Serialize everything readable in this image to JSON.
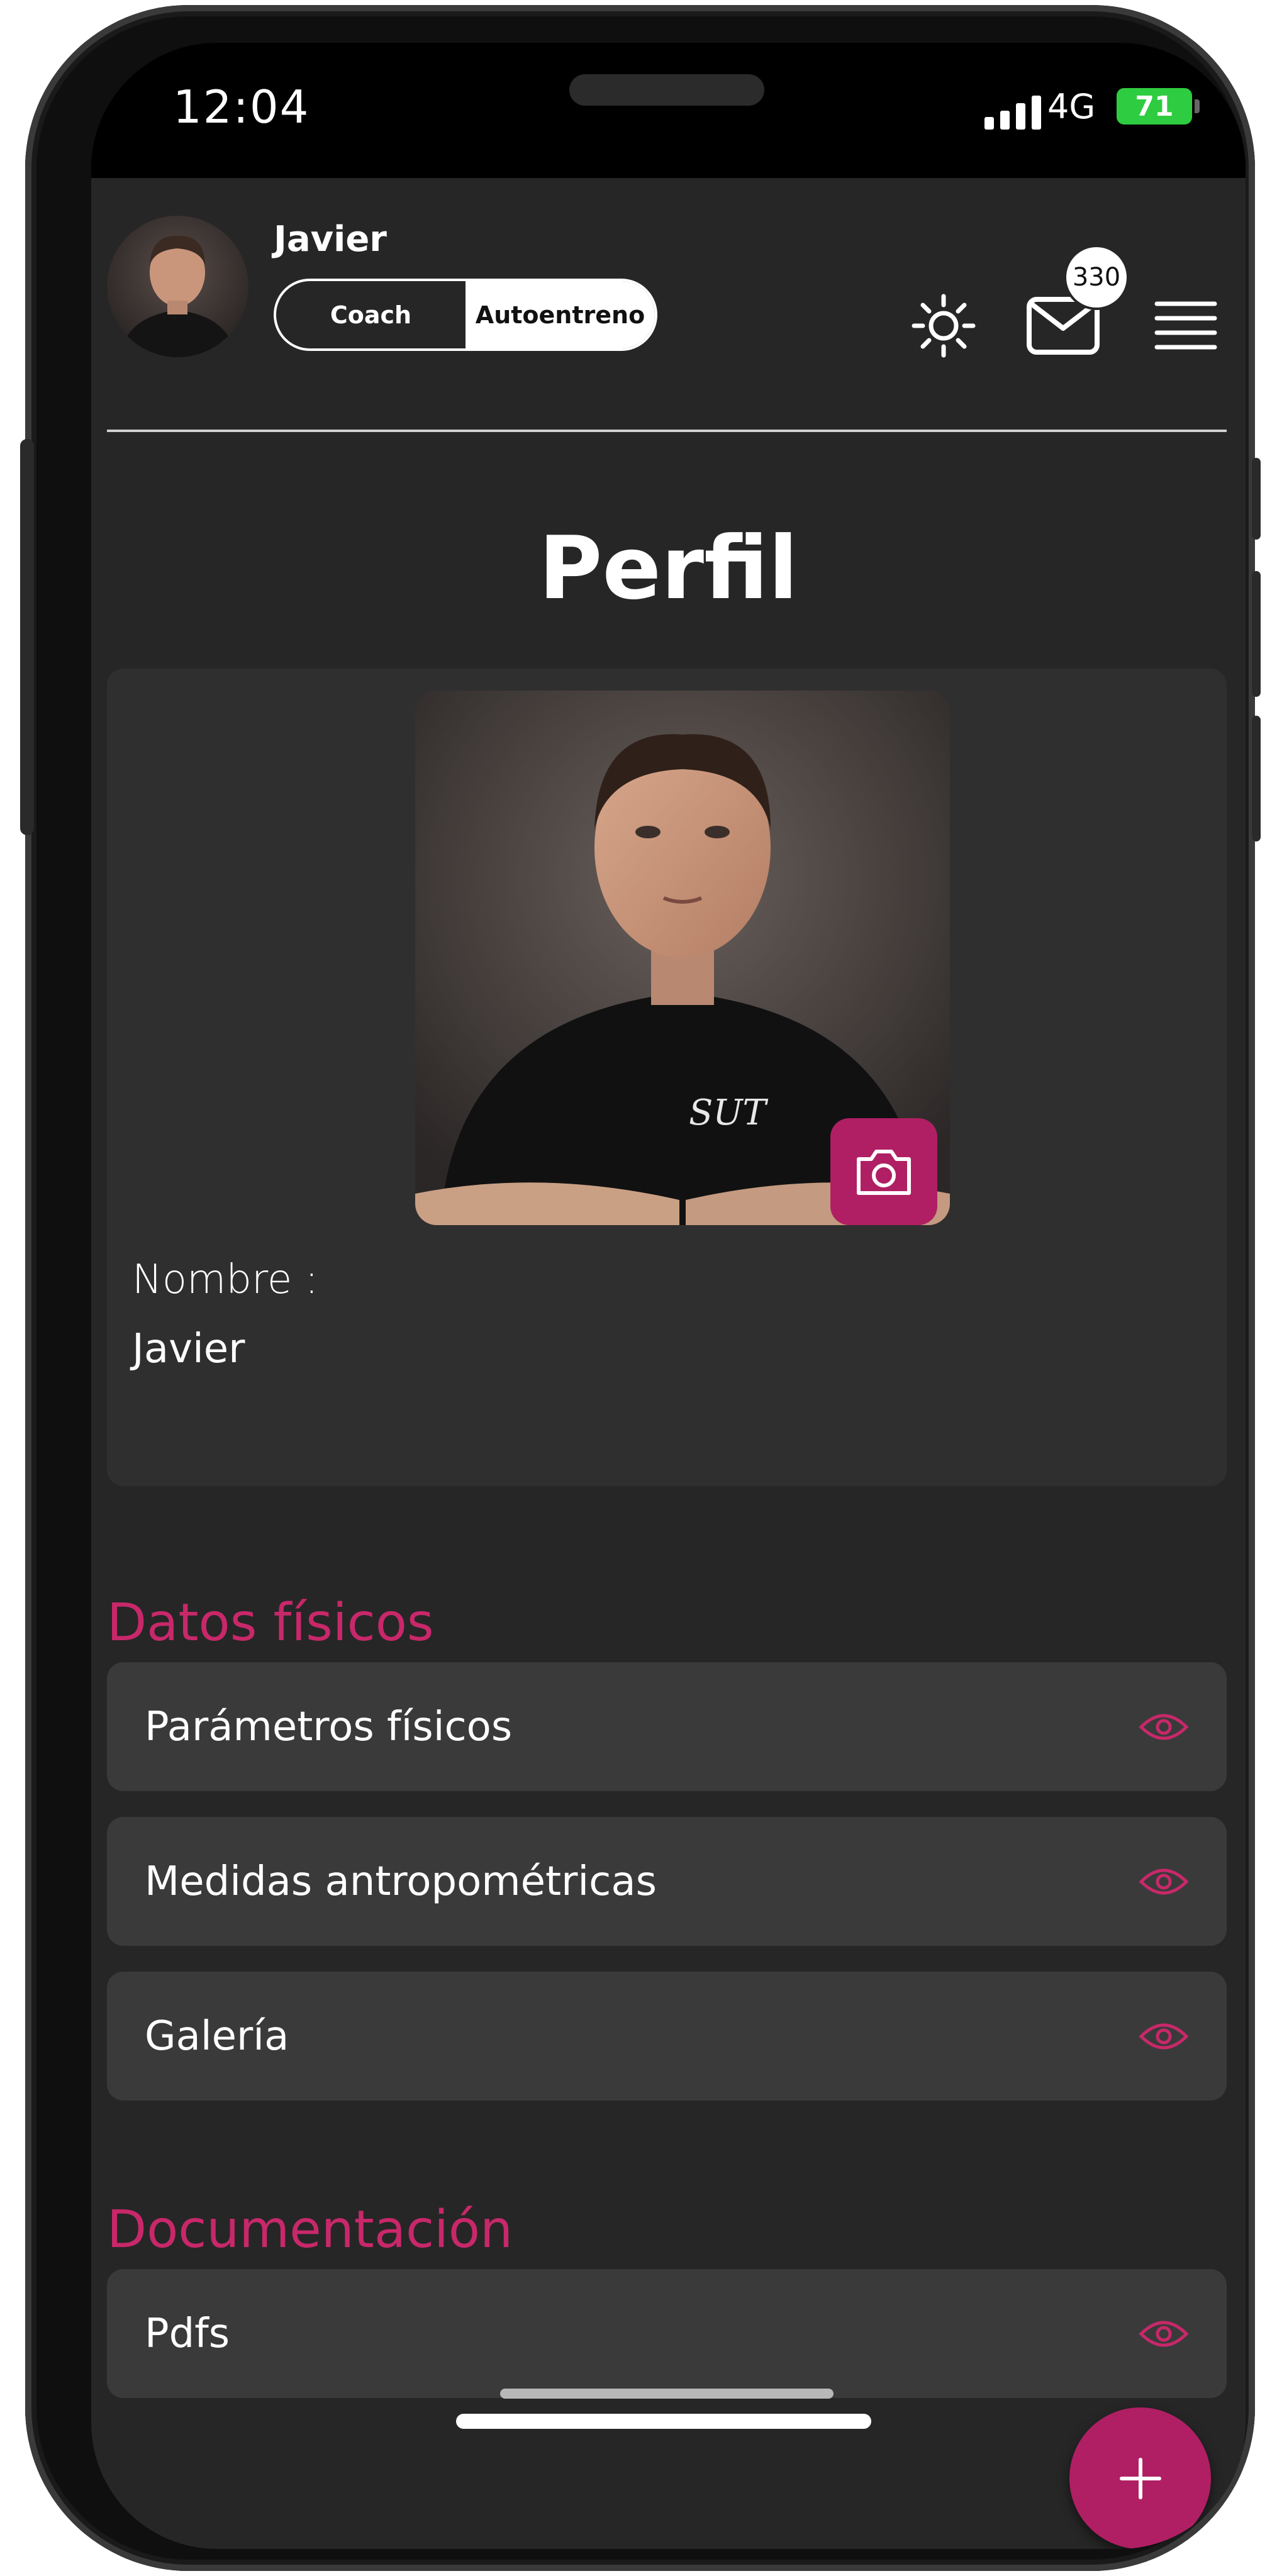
{
  "status": {
    "time": "12:04",
    "network": "4G",
    "battery": "71"
  },
  "header": {
    "user_name": "Javier",
    "mode_options": [
      "Coach",
      "Autoentreno"
    ],
    "active_mode": "Autoentreno",
    "mail_badge": "330",
    "icons": [
      "sun-icon",
      "mail-icon",
      "hamburger-menu-icon"
    ]
  },
  "page": {
    "title": "Perfil"
  },
  "profile": {
    "name_label": "Nombre :",
    "name_value": "Javier",
    "shirt_text": "SUT"
  },
  "sections": [
    {
      "title": "Datos físicos",
      "items": [
        "Parámetros físicos",
        "Medidas antropométricas",
        "Galería"
      ]
    },
    {
      "title": "Documentación",
      "items": [
        "Pdfs"
      ]
    }
  ],
  "colors": {
    "accent": "#c8286a",
    "button": "#b01f63",
    "background": "#262626",
    "card": "#2f2f2f",
    "row": "#3a3a3a"
  }
}
